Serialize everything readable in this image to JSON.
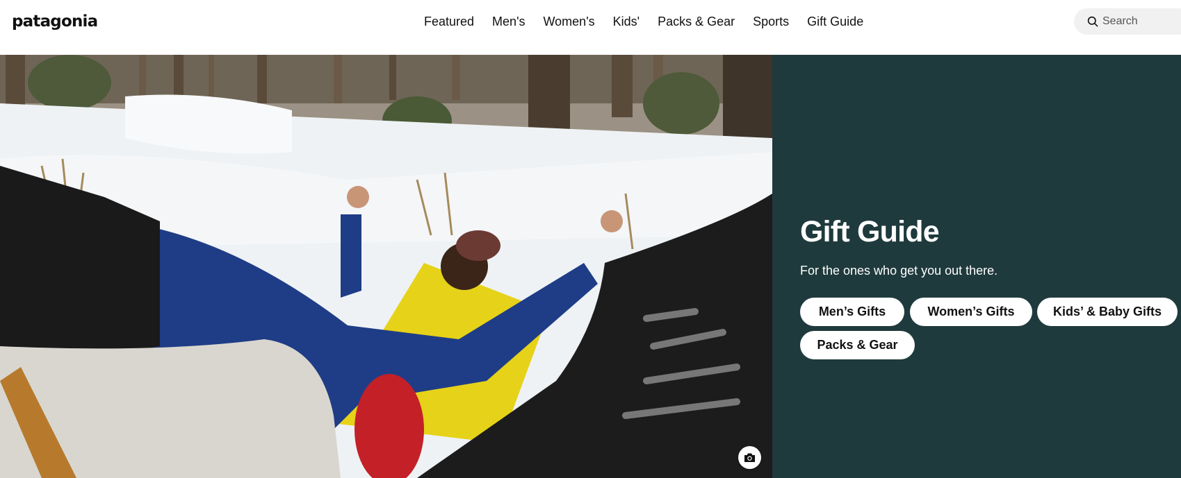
{
  "brand": {
    "logo_text": "patagonia"
  },
  "nav": {
    "items": [
      {
        "label": "Featured"
      },
      {
        "label": "Men's"
      },
      {
        "label": "Women's"
      },
      {
        "label": "Kids'"
      },
      {
        "label": "Packs & Gear"
      },
      {
        "label": "Sports"
      },
      {
        "label": "Gift Guide"
      }
    ]
  },
  "search": {
    "placeholder": "Search",
    "icon": "search-icon"
  },
  "hero": {
    "image_alt": "Person lying on a yellow sleeping pad in the snow with arms outstretched",
    "camera_icon": "camera-icon"
  },
  "panel": {
    "title": "Gift Guide",
    "subtitle": "For the ones who get you out there.",
    "buttons": [
      {
        "label": "Men’s Gifts"
      },
      {
        "label": "Women’s Gifts"
      },
      {
        "label": "Kids’ & Baby Gifts"
      },
      {
        "label": "Packs & Gear"
      }
    ]
  },
  "colors": {
    "panel_bg": "#1f3a3c",
    "pill_bg": "#ffffff",
    "header_bg": "#ffffff"
  }
}
